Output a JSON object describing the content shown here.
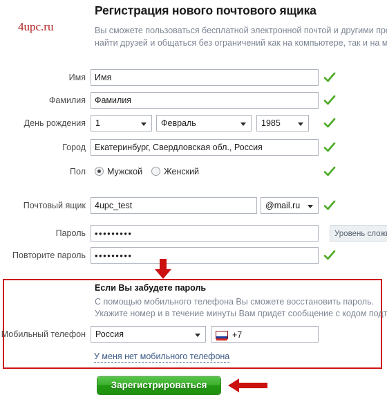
{
  "brand": {
    "logo_text": "4upc.ru",
    "logo_color": "#b32222"
  },
  "header": {
    "title": "Регистрация нового почтового ящика",
    "desc_line1": "Вы сможете пользоваться бесплатной электронной почтой и другими про",
    "desc_line2": "найти друзей и общаться без ограничений как на компьютере, так и на мо"
  },
  "form": {
    "first_name": {
      "label": "Имя",
      "value": "Имя",
      "valid": true
    },
    "last_name": {
      "label": "Фамилия",
      "value": "Фамилия",
      "valid": true
    },
    "birthday": {
      "label": "День рождения",
      "day": "1",
      "month": "Февраль",
      "year": "1985",
      "valid": true
    },
    "city": {
      "label": "Город",
      "value": "Екатеринбург, Свердловская обл., Россия",
      "valid": true
    },
    "gender": {
      "label": "Пол",
      "male_label": "Мужской",
      "female_label": "Женский",
      "selected": "male",
      "valid": true
    },
    "mailbox": {
      "label": "Почтовый ящик",
      "value": "4upc_test",
      "domain": "@mail.ru",
      "valid": true
    },
    "password": {
      "label": "Пароль",
      "value": "•••••••••",
      "strength_text": "Уровень сложнос"
    },
    "password_repeat": {
      "label": "Повторите пароль",
      "value": "•••••••••",
      "valid": true
    }
  },
  "recovery": {
    "title": "Если Вы забудете пароль",
    "desc_line1": "С помощью мобильного телефона Вы сможете восстановить пароль.",
    "desc_line2": "Укажите номер и в течение минуты Вам придет сообщение с кодом подтв",
    "phone_label": "Мобильный телефон",
    "country": "Россия",
    "dial_code": "+7",
    "no_phone_link": "У меня нет мобильного телефона"
  },
  "submit": {
    "label": "Зарегистрироваться"
  },
  "annotations": {
    "box_color": "#cc1111",
    "arrow_color": "#cc1111",
    "down_arrow_name": "red-down-arrow",
    "left_arrow_name": "red-left-arrow"
  },
  "icons": {
    "check": "check-icon",
    "caret": "chevron-down-icon",
    "flag": "russia-flag-icon"
  }
}
